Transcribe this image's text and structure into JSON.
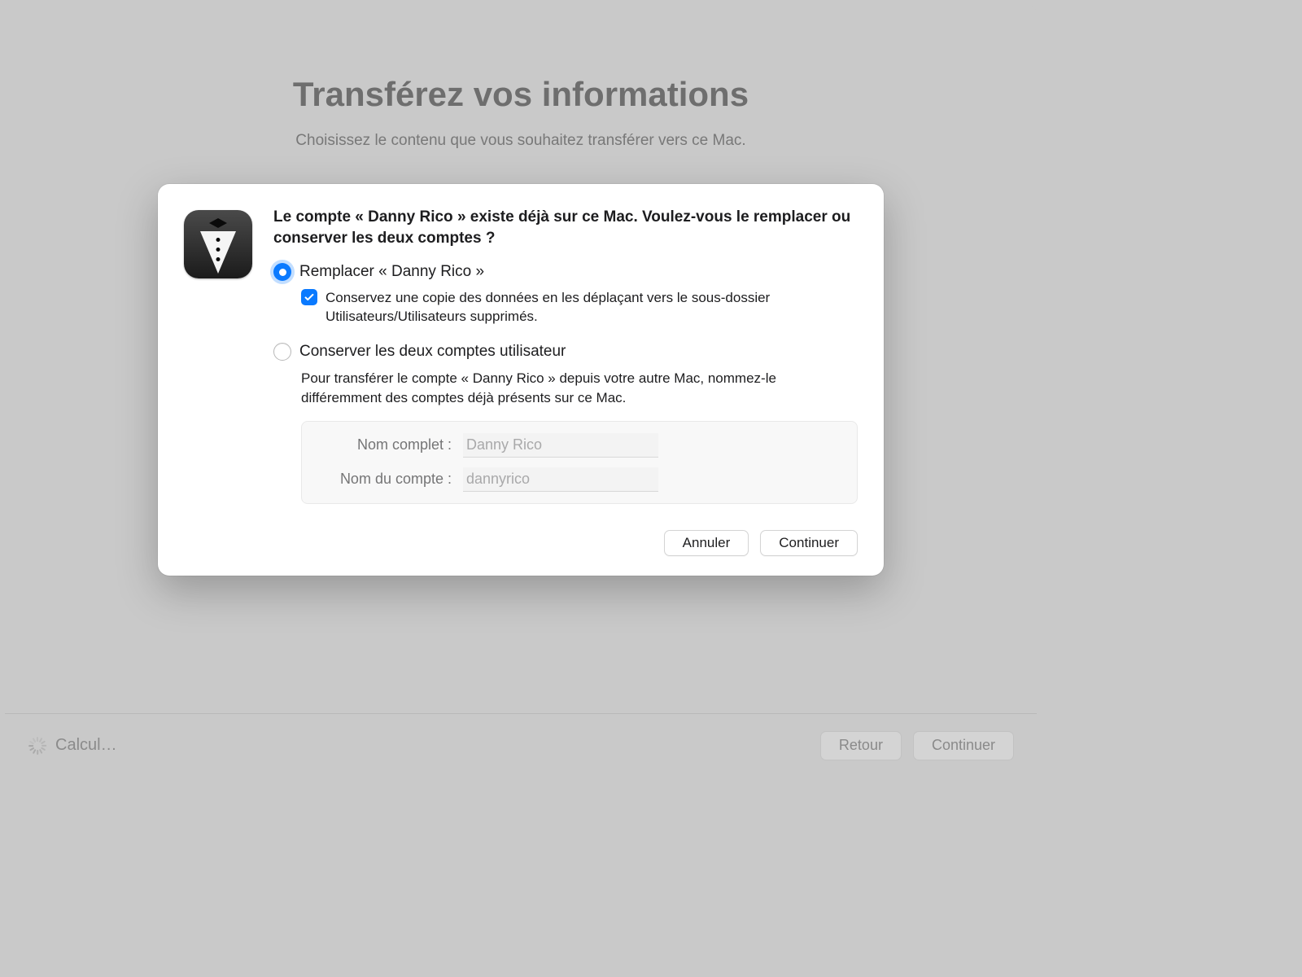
{
  "page": {
    "title": "Transférez vos informations",
    "subtitle": "Choisissez le contenu que vous souhaitez transférer vers ce Mac."
  },
  "modal": {
    "heading": "Le compte « Danny Rico » existe déjà sur ce Mac. Voulez-vous le remplacer ou conserver les deux comptes ?",
    "option_replace": {
      "label": "Remplacer « Danny Rico »",
      "selected": true,
      "preserve_copy": {
        "checked": true,
        "text": "Conservez une copie des données en les déplaçant vers le sous-dossier Utilisateurs/Utilisateurs supprimés."
      }
    },
    "option_keep": {
      "label": "Conserver les deux comptes utilisateur",
      "selected": false,
      "helper": "Pour transférer le compte « Danny Rico » depuis votre autre Mac, nommez-le différemment des comptes déjà présents sur ce Mac.",
      "full_name_label": "Nom complet :",
      "full_name_value": "Danny Rico",
      "account_name_label": "Nom du compte :",
      "account_name_value": "dannyrico"
    },
    "buttons": {
      "cancel": "Annuler",
      "continue": "Continuer"
    }
  },
  "footer": {
    "status": "Calcul…",
    "back": "Retour",
    "continue": "Continuer"
  }
}
